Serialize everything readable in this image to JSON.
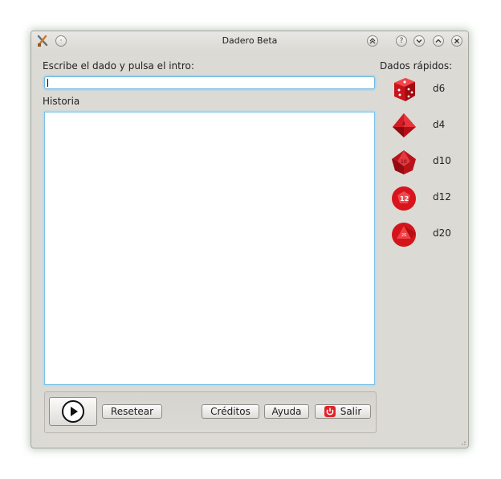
{
  "window": {
    "title": "Dadero Beta"
  },
  "main": {
    "input_label": "Escribe el dado y pulsa el intro:",
    "input_value": "",
    "history_label": "Historia"
  },
  "buttons": {
    "play_icon": "play-icon",
    "reset": "Resetear",
    "credits": "Créditos",
    "help": "Ayuda",
    "exit": "Salir"
  },
  "quick_dice": {
    "heading": "Dados rápidos:",
    "items": [
      {
        "label": "d6",
        "icon": "d6-die-icon"
      },
      {
        "label": "d4",
        "icon": "d4-die-icon"
      },
      {
        "label": "d10",
        "icon": "d10-die-icon"
      },
      {
        "label": "d12",
        "icon": "d12-die-icon"
      },
      {
        "label": "d20",
        "icon": "d20-die-icon"
      }
    ]
  },
  "colors": {
    "dice_red": "#d8141c",
    "focus_blue": "#7cc2e6",
    "window_bg": "#dcdad5"
  }
}
